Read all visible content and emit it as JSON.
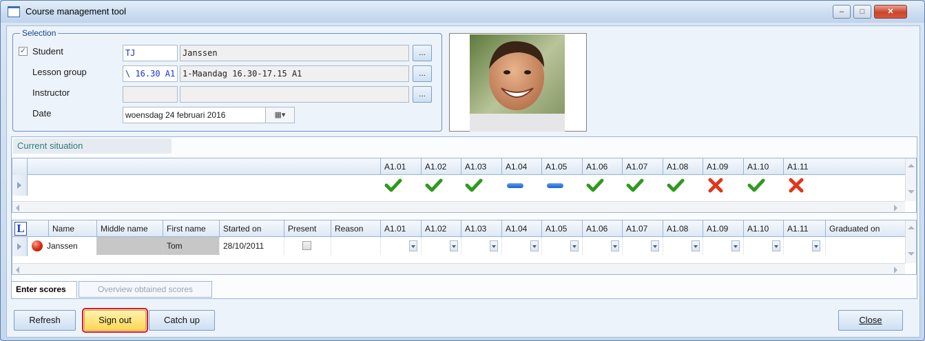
{
  "window": {
    "title": "Course management tool",
    "controls": {
      "minimize": "–",
      "maximize": "□",
      "close": "✕"
    }
  },
  "selection": {
    "legend": "Selection",
    "student": {
      "checked": true,
      "label": "Student",
      "code": "TJ",
      "name": "Janssen",
      "browse": "..."
    },
    "lesson_group": {
      "label": "Lesson group",
      "code": "\\ 16.30 A1",
      "name": "1-Maandag 16.30-17.15 A1",
      "browse": "..."
    },
    "instructor": {
      "label": "Instructor",
      "code": "",
      "name": "",
      "browse": "..."
    },
    "date": {
      "label": "Date",
      "value": "woensdag 24 februari 2016"
    }
  },
  "current_situation": {
    "tab_label": "Current situation",
    "columns": [
      "A1.01",
      "A1.02",
      "A1.03",
      "A1.04",
      "A1.05",
      "A1.06",
      "A1.07",
      "A1.08",
      "A1.09",
      "A1.10",
      "A1.11"
    ],
    "status": [
      "check",
      "check",
      "check",
      "dash",
      "dash",
      "check",
      "check",
      "check",
      "cross",
      "check",
      "cross"
    ]
  },
  "scores_grid": {
    "corner_icon": "L",
    "headers": {
      "name": "Name",
      "middle_name": "Middle name",
      "first_name": "First name",
      "started_on": "Started on",
      "present": "Present",
      "reason": "Reason",
      "graduated_on": "Graduated on"
    },
    "rows": [
      {
        "name": "Janssen",
        "middle_name": "",
        "first_name": "Tom",
        "started_on": "28/10/2011",
        "present": false,
        "reason": "",
        "graduated_on": "",
        "status_color": "#d62a10"
      }
    ]
  },
  "bottom_tabs": [
    "Enter scores",
    "Overview obtained scores"
  ],
  "buttons": {
    "refresh": "Refresh",
    "sign_out": "Sign out",
    "catch_up": "Catch up",
    "close": "Close"
  },
  "colors": {
    "check": "#2e9a1e",
    "cross": "#e0361a",
    "dash": "#1d5fd0",
    "highlight": "#e0161d"
  }
}
